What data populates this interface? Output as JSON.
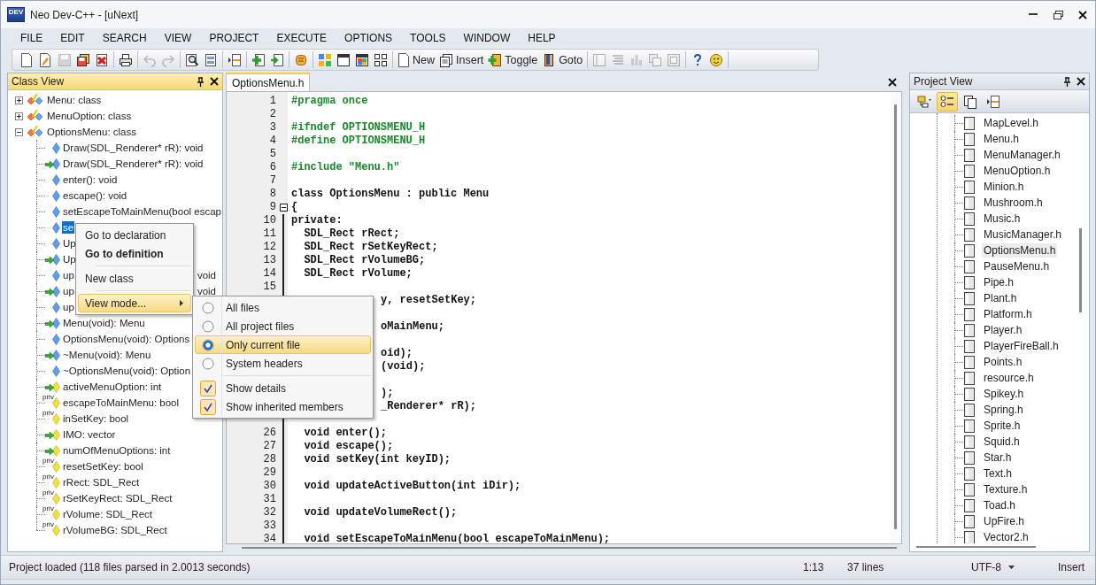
{
  "window": {
    "icon_label": "DEV",
    "title": "Neo Dev-C++ - [uNext]"
  },
  "menu": [
    "FILE",
    "EDIT",
    "SEARCH",
    "VIEW",
    "PROJECT",
    "EXECUTE",
    "OPTIONS",
    "TOOLS",
    "WINDOW",
    "HELP"
  ],
  "toolbar": [
    {
      "buttons": [
        {
          "disabled": false
        },
        {
          "disabled": false
        },
        {
          "disabled": true
        },
        {
          "disabled": false
        },
        {
          "disabled": false
        }
      ]
    },
    {
      "buttons": [
        {
          "disabled": false
        }
      ]
    },
    {
      "buttons": [
        {
          "disabled": true
        },
        {
          "disabled": true
        }
      ]
    },
    {
      "buttons": [
        {
          "disabled": false
        },
        {
          "disabled": false
        }
      ]
    },
    {
      "buttons": [
        {
          "disabled": false
        }
      ]
    },
    {
      "buttons": [
        {
          "disabled": false
        },
        {
          "disabled": false
        }
      ]
    },
    {
      "buttons": [
        {
          "disabled": false
        }
      ]
    },
    {
      "buttons": [
        {
          "disabled": false
        },
        {
          "disabled": false
        },
        {
          "disabled": false
        },
        {
          "disabled": false
        }
      ]
    },
    {
      "buttons": [
        {
          "label": "New",
          "disabled": false
        },
        {
          "label": "Insert",
          "disabled": false
        },
        {
          "label": "Toggle",
          "disabled": false
        },
        {
          "label": "Goto",
          "disabled": false
        }
      ]
    },
    {
      "buttons": [
        {
          "disabled": true
        },
        {
          "disabled": true
        },
        {
          "disabled": true
        },
        {
          "disabled": true
        },
        {
          "disabled": true
        }
      ]
    },
    {
      "buttons": [
        {
          "disabled": false
        },
        {
          "disabled": false
        }
      ]
    }
  ],
  "class_view": {
    "title": "Class View",
    "items": [
      {
        "text": "Menu: class",
        "expanded": false,
        "selected": false
      },
      {
        "text": "MenuOption: class",
        "expanded": false,
        "selected": false
      },
      {
        "text": "OptionsMenu: class",
        "expanded": true,
        "selected": false,
        "children": [
          {
            "kind": "method",
            "text": "Draw(SDL_Renderer* rR): void",
            "inherited": false,
            "selected": false
          },
          {
            "kind": "method",
            "text": "Draw(SDL_Renderer* rR): void",
            "inherited": true,
            "selected": false
          },
          {
            "kind": "method",
            "text": "enter(): void",
            "inherited": false,
            "selected": false
          },
          {
            "kind": "method",
            "text": "escape(): void",
            "inherited": false,
            "selected": false
          },
          {
            "kind": "method",
            "text": "setEscapeToMainMenu(bool escap",
            "inherited": false,
            "selected": false
          },
          {
            "kind": "method",
            "text": "se",
            "inherited": false,
            "selected": true
          },
          {
            "kind": "method",
            "text": "Up",
            "inherited": false,
            "selected": false
          },
          {
            "kind": "method",
            "text": "Up",
            "inherited": true,
            "selected": false
          },
          {
            "kind": "method",
            "text": "up",
            "tail": "void",
            "inherited": false,
            "selected": false
          },
          {
            "kind": "method",
            "text": "up",
            "tail": "void",
            "inherited": true,
            "selected": false
          },
          {
            "kind": "method",
            "text": "up",
            "inherited": false,
            "selected": false
          },
          {
            "kind": "method",
            "text": "Menu(void): Menu",
            "inherited": true,
            "selected": false
          },
          {
            "kind": "method",
            "text": "OptionsMenu(void): Options",
            "inherited": false,
            "selected": false
          },
          {
            "kind": "method",
            "text": "~Menu(void): Menu",
            "inherited": true,
            "selected": false
          },
          {
            "kind": "method",
            "text": "~OptionsMenu(void): Option",
            "inherited": false,
            "selected": false
          },
          {
            "kind": "field",
            "text": "activeMenuOption: int",
            "inherited": true,
            "selected": false
          },
          {
            "kind": "field",
            "text": "escapeToMainMenu: bool",
            "badge": "priv",
            "inherited": false,
            "selected": false
          },
          {
            "kind": "field",
            "text": "inSetKey: bool",
            "badge": "priv",
            "inherited": false,
            "selected": false
          },
          {
            "kind": "field",
            "text": "IMO: vector",
            "inherited": true,
            "selected": false
          },
          {
            "kind": "field",
            "text": "numOfMenuOptions: int",
            "inherited": true,
            "selected": false
          },
          {
            "kind": "field",
            "text": "resetSetKey: bool",
            "badge": "priv",
            "inherited": false,
            "selected": false
          },
          {
            "kind": "field",
            "text": "rRect: SDL_Rect",
            "badge": "priv",
            "inherited": false,
            "selected": false
          },
          {
            "kind": "field",
            "text": "rSetKeyRect: SDL_Rect",
            "badge": "priv",
            "inherited": false,
            "selected": false
          },
          {
            "kind": "field",
            "text": "rVolume: SDL_Rect",
            "badge": "priv",
            "inherited": false,
            "selected": false
          },
          {
            "kind": "field",
            "text": "rVolumeBG: SDL_Rect",
            "badge": "priv",
            "inherited": false,
            "selected": false
          }
        ]
      }
    ]
  },
  "context_menu": {
    "items": [
      {
        "kind": "item",
        "text": "Go to declaration",
        "default": false,
        "highlighted": false
      },
      {
        "kind": "item",
        "text": "Go to definition",
        "default": true,
        "highlighted": false
      },
      {
        "kind": "separator"
      },
      {
        "kind": "item",
        "text": "New class",
        "default": false,
        "highlighted": false
      },
      {
        "kind": "separator"
      },
      {
        "kind": "submenu",
        "text": "View mode...",
        "default": false,
        "highlighted": true
      }
    ]
  },
  "submenu": {
    "items": [
      {
        "kind": "radio",
        "text": "All files",
        "selected": false,
        "highlighted": false
      },
      {
        "kind": "radio",
        "text": "All project files",
        "selected": false,
        "highlighted": false
      },
      {
        "kind": "radio",
        "text": "Only current file",
        "selected": true,
        "highlighted": true
      },
      {
        "kind": "radio",
        "text": "System headers",
        "selected": false,
        "highlighted": false
      },
      {
        "kind": "separator"
      },
      {
        "kind": "check",
        "text": "Show details",
        "checked": true,
        "highlighted": false
      },
      {
        "kind": "check",
        "text": "Show inherited members",
        "checked": true,
        "highlighted": false
      }
    ]
  },
  "editor": {
    "tabs": [
      {
        "label": "OptionsMenu.h",
        "selected": true
      }
    ],
    "lines": [
      {
        "number": "1",
        "kind": "preprocessor",
        "text": "#pragma once"
      },
      {
        "number": "2"
      },
      {
        "number": "3",
        "kind": "preprocessor",
        "text": "#ifndef OPTIONSMENU_H"
      },
      {
        "number": "4",
        "kind": "preprocessor",
        "text": "#define OPTIONSMENU_H"
      },
      {
        "number": "5"
      },
      {
        "number": "6",
        "kind": "preprocessor",
        "text": "#include \"Menu.h\""
      },
      {
        "number": "7"
      },
      {
        "number": "8",
        "kind": "code",
        "text": "class OptionsMenu : public Menu"
      },
      {
        "number": "9",
        "kind": "code",
        "text": "{",
        "expanded": true
      },
      {
        "number": "10",
        "kind": "code",
        "text": "private:"
      },
      {
        "number": "11",
        "kind": "code",
        "text": "  SDL_Rect rRect;"
      },
      {
        "number": "12",
        "kind": "code",
        "text": "  SDL_Rect rSetKeyRect;"
      },
      {
        "number": "13",
        "kind": "code",
        "text": "  SDL_Rect rVolumeBG;"
      },
      {
        "number": "14",
        "kind": "code",
        "text": "  SDL_Rect rVolume;"
      },
      {
        "number": "15"
      },
      {
        "kind": "code",
        "text": "y, resetSetKey;",
        "clipped": true
      },
      {
        "kind": "blank"
      },
      {
        "kind": "code",
        "text": "oMainMenu;",
        "clipped": true
      },
      {
        "kind": "blank"
      },
      {
        "kind": "code",
        "text": "oid);",
        "clipped": true
      },
      {
        "kind": "code",
        "text": "(void);",
        "clipped": true
      },
      {
        "kind": "blank"
      },
      {
        "kind": "code",
        "text": ");",
        "clipped": true
      },
      {
        "kind": "code",
        "text": "_Renderer* rR);",
        "clipped": true
      },
      {
        "kind": "blank"
      },
      {
        "number": "26",
        "kind": "code",
        "text": "  void enter();"
      },
      {
        "number": "27",
        "kind": "code",
        "text": "  void escape();"
      },
      {
        "number": "28",
        "kind": "code",
        "text": "  void setKey(int keyID);"
      },
      {
        "number": "29"
      },
      {
        "number": "30",
        "kind": "code",
        "text": "  void updateActiveButton(int iDir);"
      },
      {
        "number": "31"
      },
      {
        "number": "32",
        "kind": "code",
        "text": "  void updateVolumeRect();"
      },
      {
        "number": "33"
      },
      {
        "number": "34",
        "kind": "code",
        "text": "  void setEscapeToMainMenu(bool escapeToMainMenu);"
      }
    ]
  },
  "project_view": {
    "title": "Project View",
    "toolbar": [
      {
        "selected": false
      },
      {
        "selected": true
      },
      {
        "selected": false
      },
      {
        "selected": false
      }
    ],
    "files": [
      {
        "name": "MapLevel.h",
        "selected": false
      },
      {
        "name": "Menu.h",
        "selected": false
      },
      {
        "name": "MenuManager.h",
        "selected": false
      },
      {
        "name": "MenuOption.h",
        "selected": false
      },
      {
        "name": "Minion.h",
        "selected": false
      },
      {
        "name": "Mushroom.h",
        "selected": false
      },
      {
        "name": "Music.h",
        "selected": false
      },
      {
        "name": "MusicManager.h",
        "selected": false
      },
      {
        "name": "OptionsMenu.h",
        "selected": true
      },
      {
        "name": "PauseMenu.h",
        "selected": false
      },
      {
        "name": "Pipe.h",
        "selected": false
      },
      {
        "name": "Plant.h",
        "selected": false
      },
      {
        "name": "Platform.h",
        "selected": false
      },
      {
        "name": "Player.h",
        "selected": false
      },
      {
        "name": "PlayerFireBall.h",
        "selected": false
      },
      {
        "name": "Points.h",
        "selected": false
      },
      {
        "name": "resource.h",
        "selected": false
      },
      {
        "name": "Spikey.h",
        "selected": false
      },
      {
        "name": "Spring.h",
        "selected": false
      },
      {
        "name": "Sprite.h",
        "selected": false
      },
      {
        "name": "Squid.h",
        "selected": false
      },
      {
        "name": "Star.h",
        "selected": false
      },
      {
        "name": "Text.h",
        "selected": false
      },
      {
        "name": "Texture.h",
        "selected": false
      },
      {
        "name": "Toad.h",
        "selected": false
      },
      {
        "name": "UpFire.h",
        "selected": false
      },
      {
        "name": "Vector2.h",
        "selected": false
      }
    ]
  },
  "status_bar": {
    "message": "Project loaded (118 files parsed in 2.0013 seconds)",
    "position": "1:13",
    "lines": "37 lines",
    "encoding": "UTF-8",
    "mode": "Insert"
  }
}
